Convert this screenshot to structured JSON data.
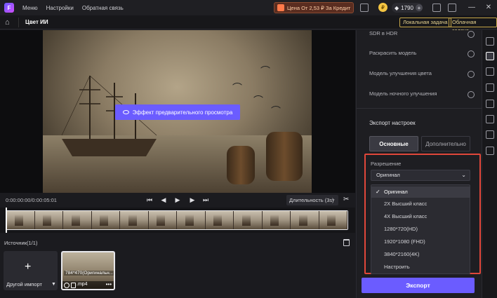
{
  "topbar": {
    "logo": "F",
    "menu": [
      "Меню",
      "Настройки",
      "Обратная связь"
    ],
    "promo": "Цена От 2,53 ₽ За Кредит",
    "credits": "1790",
    "coin_icon": "coin-icon",
    "win_minimize": "—",
    "win_close": "✕"
  },
  "subbar": {
    "title": "Цвет ИИ",
    "local_task": "Локальная задача",
    "cloud_task": "Облачная задача"
  },
  "preview": {
    "button": "Эффект предварительного просмотра"
  },
  "player": {
    "timecode": "0:00:00:00/0:00:05:01",
    "duration": "Длительность (3s)",
    "caret": "⌄"
  },
  "sources": {
    "title": "Источник(1/1)",
    "import_label": "Другой импорт",
    "import_plus": "+",
    "clip_resolution": "784*470(Оригинальн...",
    "clip_ext": ".mp4",
    "clip_more": "•••"
  },
  "panel": {
    "options": [
      {
        "label": "SDR в HDR"
      },
      {
        "label": "Раскрасить модель"
      },
      {
        "label": "Модель улучшения цвета"
      },
      {
        "label": "Модель ночного улучшения"
      }
    ],
    "export_title": "Экспорт настроек",
    "tab_basic": "Основные",
    "tab_advanced": "Дополнительно",
    "resolution_label": "Разрешение",
    "resolution_selected": "Оригинал",
    "resolution_options": [
      {
        "label": "Оригинал",
        "check": "✓"
      },
      {
        "label": "2X Высший класс",
        "check": ""
      },
      {
        "label": "4X Высший класс",
        "check": ""
      },
      {
        "label": "1280*720(HD)",
        "check": ""
      },
      {
        "label": "1920*1080 (FHD)",
        "check": ""
      },
      {
        "label": "3840*2160(4K)",
        "check": ""
      },
      {
        "label": "Настроить",
        "check": ""
      }
    ],
    "export_button": "Экспорт"
  },
  "colors": {
    "accent": "#6b5cff",
    "highlight_border": "#e0473a",
    "task_border": "#c9a94a"
  }
}
